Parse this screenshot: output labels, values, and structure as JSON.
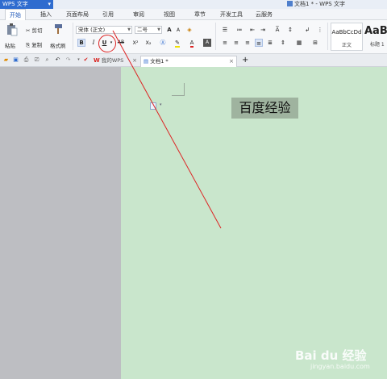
{
  "titlebar": {
    "app_label": "WPS 文字",
    "app_arrow": "▾",
    "doc_title": "文档1 * - WPS 文字"
  },
  "menu": [
    "开始",
    "插入",
    "页面布局",
    "引用",
    "审阅",
    "视图",
    "章节",
    "开发工具",
    "云服务"
  ],
  "ribbon": {
    "paste": "粘贴",
    "cut": "剪切",
    "copy": "复制",
    "format_painter": "格式刷",
    "font_name": "宋体 (正文)",
    "font_size": "二号",
    "grow_font": "A",
    "shrink_font": "A",
    "bold": "B",
    "italic": "I",
    "underline": "U",
    "strikethrough": "AB",
    "superscript": "X²",
    "subscript": "X₂",
    "style_normal_sample": "AaBbCcDd",
    "style_normal_label": "正文",
    "style_h1_sample": "AaB",
    "style_h1_label": "标题 1"
  },
  "tabs": {
    "my_wps": "我的WPS",
    "doc1": "文档1 *",
    "close": "×",
    "new_tab": "+"
  },
  "document": {
    "selected_text": "百度经验"
  },
  "watermark": {
    "brand": "Bai du 经验",
    "url": "jingyan.baidu.com"
  },
  "colors": {
    "app_blue": "#2f6ccf",
    "page_green": "#c9e6cc",
    "selection": "#9fb39f",
    "annotation_red": "#dd2222"
  }
}
